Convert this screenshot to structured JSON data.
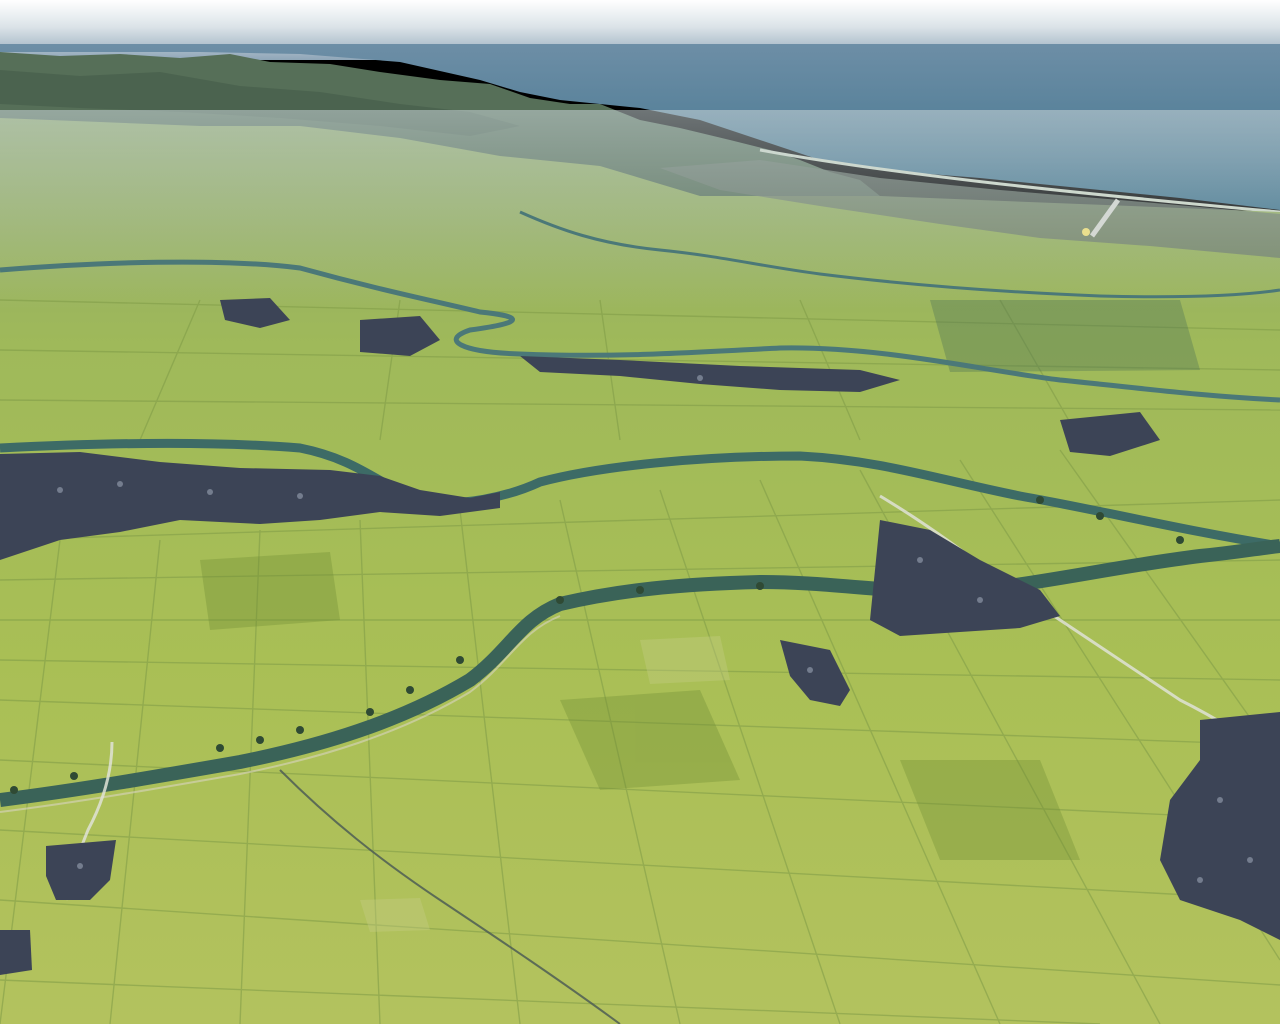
{
  "scene": {
    "kind": "flight-simulator-aerial-view",
    "labels": [],
    "colors": {
      "sky": "#5f7e9c",
      "sea": "#4f7f96",
      "mountains": "#55705a",
      "farmland_light": "#aabf5a",
      "farmland_dark": "#7f9d3e",
      "river": "#3d6f6e",
      "village": "#3e4658",
      "road": "#d8ddd0"
    }
  }
}
